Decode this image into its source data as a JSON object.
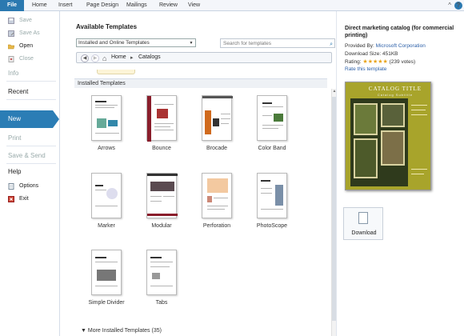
{
  "ribbon": {
    "tabs": [
      "File",
      "Home",
      "Insert",
      "Page Design",
      "Mailings",
      "Review",
      "View"
    ],
    "window_buttons": [
      "^",
      "?"
    ]
  },
  "sidebar": {
    "save": "Save",
    "save_as": "Save As",
    "open": "Open",
    "close": "Close",
    "info": "Info",
    "recent": "Recent",
    "new": "New",
    "print": "Print",
    "save_send": "Save & Send",
    "help": "Help",
    "options": "Options",
    "exit": "Exit"
  },
  "main": {
    "title": "Available Templates",
    "source_select": "Installed and Online Templates",
    "search_placeholder": "Search for templates",
    "nav_home": "Home",
    "nav_sep": "▸",
    "nav_current": "Catalogs",
    "section_label": "Installed Templates",
    "more_label": "More Installed Templates (35)",
    "templates": [
      "Arrows",
      "Bounce",
      "Brocade",
      "Color Band",
      "Marker",
      "Modular",
      "Perforation",
      "PhotoScope",
      "Simple Divider",
      "Tabs"
    ]
  },
  "details": {
    "title": "Direct marketing catalog (for commercial printing)",
    "provided_by_label": "Provided By:",
    "provided_by": "Microsoft Corporation",
    "download_size": "Download Size: 451KB",
    "rating_label": "Rating:",
    "rating_stars": "★★★★★",
    "rating_votes": "(239 votes)",
    "rating_value": 4.5,
    "rate_link": "Rate this template",
    "preview_title": "CATALOG TITLE",
    "preview_subtitle": "Catalog Subtitle",
    "download_button": "Download"
  },
  "colors": {
    "accent": "#2b7db5",
    "preview_bg": "#a8a42b"
  }
}
